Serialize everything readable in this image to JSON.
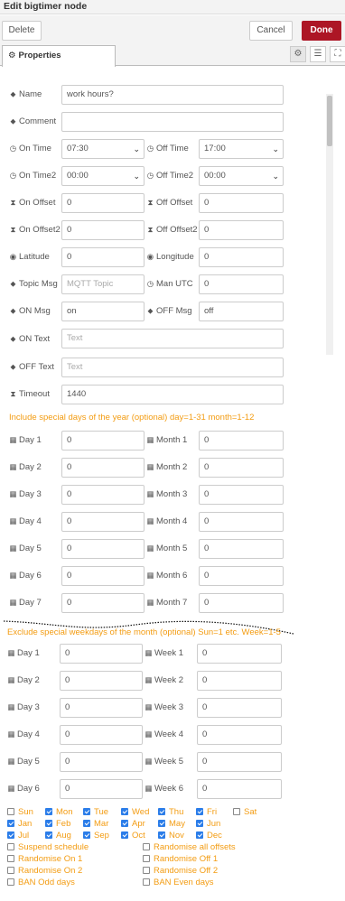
{
  "title": "Edit bigtimer node",
  "toolbar": {
    "delete": "Delete",
    "cancel": "Cancel",
    "done": "Done"
  },
  "tabs": {
    "properties": "Properties"
  },
  "icons": {
    "gear": "⚙",
    "doc": "☰",
    "frame": "⛶",
    "tag": "⬥",
    "clock": "◷",
    "hourglass": "⧗",
    "globe": "◉",
    "calendar": "▦"
  },
  "fields": {
    "name": {
      "label": "Name",
      "value": "work hours?"
    },
    "comment": {
      "label": "Comment",
      "value": ""
    },
    "on_time": {
      "label": "On Time",
      "value": "07:30"
    },
    "off_time": {
      "label": "Off Time",
      "value": "17:00"
    },
    "on_time2": {
      "label": "On Time2",
      "value": "00:00"
    },
    "off_time2": {
      "label": "Off Time2",
      "value": "00:00"
    },
    "on_offset": {
      "label": "On Offset",
      "value": "0"
    },
    "off_offset": {
      "label": "Off Offset",
      "value": "0"
    },
    "on_offset2": {
      "label": "On Offset2",
      "value": "0"
    },
    "off_offset2": {
      "label": "Off Offset2",
      "value": "0"
    },
    "latitude": {
      "label": "Latitude",
      "value": "0"
    },
    "longitude": {
      "label": "Longitude",
      "value": "0"
    },
    "topic_msg": {
      "label": "Topic Msg",
      "placeholder": "MQTT Topic"
    },
    "man_utc": {
      "label": "Man UTC",
      "value": "0"
    },
    "on_msg": {
      "label": "ON Msg",
      "value": "on"
    },
    "off_msg": {
      "label": "OFF Msg",
      "value": "off"
    },
    "on_text": {
      "label": "ON Text",
      "placeholder": "Text"
    },
    "off_text": {
      "label": "OFF Text",
      "placeholder": "Text"
    },
    "timeout": {
      "label": "Timeout",
      "value": "1440"
    }
  },
  "special_days": {
    "note": "Include special days of the year (optional) day=1-31 month=1-12",
    "rows": [
      {
        "day_label": "Day 1",
        "day": "0",
        "month_label": "Month 1",
        "month": "0"
      },
      {
        "day_label": "Day 2",
        "day": "0",
        "month_label": "Month 2",
        "month": "0"
      },
      {
        "day_label": "Day 3",
        "day": "0",
        "month_label": "Month 3",
        "month": "0"
      },
      {
        "day_label": "Day 4",
        "day": "0",
        "month_label": "Month 4",
        "month": "0"
      },
      {
        "day_label": "Day 5",
        "day": "0",
        "month_label": "Month 5",
        "month": "0"
      },
      {
        "day_label": "Day 6",
        "day": "0",
        "month_label": "Month 6",
        "month": "0"
      },
      {
        "day_label": "Day 7",
        "day": "0",
        "month_label": "Month 7",
        "month": "0"
      }
    ]
  },
  "weekdays": {
    "note": "Exclude special weekdays of the month (optional) Sun=1 etc. Week=1-5",
    "rows": [
      {
        "day_label": "Day 1",
        "day": "0",
        "week_label": "Week 1",
        "week": "0"
      },
      {
        "day_label": "Day 2",
        "day": "0",
        "week_label": "Week 2",
        "week": "0"
      },
      {
        "day_label": "Day 3",
        "day": "0",
        "week_label": "Week 3",
        "week": "0"
      },
      {
        "day_label": "Day 4",
        "day": "0",
        "week_label": "Week 4",
        "week": "0"
      },
      {
        "day_label": "Day 5",
        "day": "0",
        "week_label": "Week 5",
        "week": "0"
      },
      {
        "day_label": "Day 6",
        "day": "0",
        "week_label": "Week 6",
        "week": "0"
      }
    ]
  },
  "days_checks": [
    {
      "label": "Sun",
      "checked": false
    },
    {
      "label": "Mon",
      "checked": true
    },
    {
      "label": "Tue",
      "checked": true
    },
    {
      "label": "Wed",
      "checked": true
    },
    {
      "label": "Thu",
      "checked": true
    },
    {
      "label": "Fri",
      "checked": true
    },
    {
      "label": "Sat",
      "checked": false
    }
  ],
  "month_checks": [
    {
      "label": "Jan",
      "checked": true
    },
    {
      "label": "Feb",
      "checked": true
    },
    {
      "label": "Mar",
      "checked": true
    },
    {
      "label": "Apr",
      "checked": true
    },
    {
      "label": "May",
      "checked": true
    },
    {
      "label": "Jun",
      "checked": true
    },
    {
      "label": "Jul",
      "checked": true
    },
    {
      "label": "Aug",
      "checked": true
    },
    {
      "label": "Sep",
      "checked": true
    },
    {
      "label": "Oct",
      "checked": true
    },
    {
      "label": "Nov",
      "checked": true
    },
    {
      "label": "Dec",
      "checked": true
    }
  ],
  "options": [
    {
      "label": "Suspend schedule",
      "checked": false
    },
    {
      "label": "Randomise all offsets",
      "checked": false
    },
    {
      "label": "Randomise On 1",
      "checked": false
    },
    {
      "label": "Randomise Off 1",
      "checked": false
    },
    {
      "label": "Randomise On 2",
      "checked": false
    },
    {
      "label": "Randomise Off 2",
      "checked": false
    },
    {
      "label": "BAN Odd days",
      "checked": false
    },
    {
      "label": "BAN Even days",
      "checked": false
    }
  ]
}
